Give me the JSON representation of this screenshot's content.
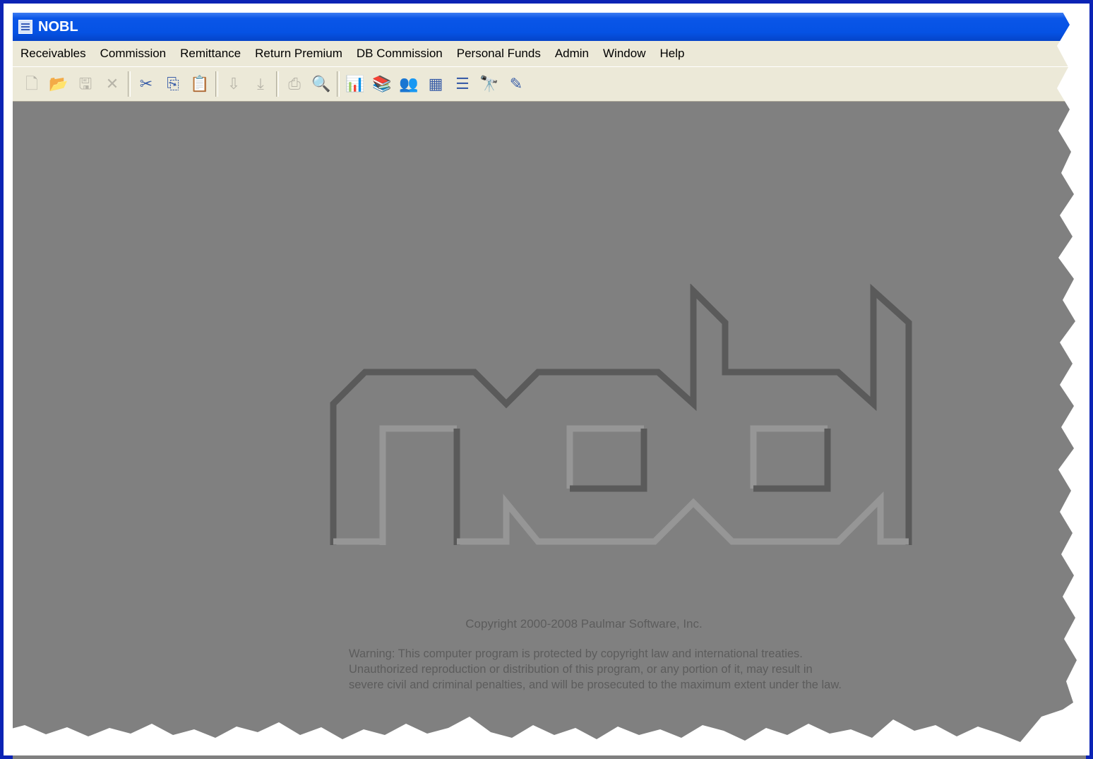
{
  "window": {
    "title": "NOBL"
  },
  "menu": [
    "Receivables",
    "Commission",
    "Remittance",
    "Return Premium",
    "DB Commission",
    "Personal Funds",
    "Admin",
    "Window",
    "Help"
  ],
  "toolbar": {
    "groups": [
      [
        {
          "icon": "new-icon",
          "glyph": "🗋",
          "enabled": false
        },
        {
          "icon": "open-icon",
          "glyph": "📂",
          "enabled": false
        },
        {
          "icon": "save-icon",
          "glyph": "🖫",
          "enabled": false
        },
        {
          "icon": "delete-icon",
          "glyph": "✕",
          "enabled": false
        }
      ],
      [
        {
          "icon": "cut-icon",
          "glyph": "✂",
          "enabled": true
        },
        {
          "icon": "copy-icon",
          "glyph": "⎘",
          "enabled": true
        },
        {
          "icon": "paste-icon",
          "glyph": "📋",
          "enabled": true
        }
      ],
      [
        {
          "icon": "import-icon",
          "glyph": "⇩",
          "enabled": false
        },
        {
          "icon": "export-icon",
          "glyph": "⤓",
          "enabled": false
        }
      ],
      [
        {
          "icon": "print-icon",
          "glyph": "⎙",
          "enabled": false
        },
        {
          "icon": "print-preview-icon",
          "glyph": "🔍",
          "enabled": false
        }
      ],
      [
        {
          "icon": "report-icon",
          "glyph": "📊",
          "enabled": true
        },
        {
          "icon": "stack-icon",
          "glyph": "📚",
          "enabled": true
        },
        {
          "icon": "users-icon",
          "glyph": "👥",
          "enabled": true
        },
        {
          "icon": "calculator-icon",
          "glyph": "▦",
          "enabled": true
        },
        {
          "icon": "list-icon",
          "glyph": "☰",
          "enabled": true
        },
        {
          "icon": "find-icon",
          "glyph": "🔭",
          "enabled": true
        },
        {
          "icon": "notepad-icon",
          "glyph": "✎",
          "enabled": true
        }
      ]
    ]
  },
  "splash": {
    "logo_text": "nobl",
    "copyright": "Copyright 2000-2008 Paulmar Software, Inc.",
    "warning_lines": [
      "Warning:   This  computer program is protected by copyright law and international treaties.",
      "Unauthorized reproduction or distribution of this program, or any portion of it, may result in",
      "severe civil and criminal penalties, and will be prosecuted to the maximum extent under the law."
    ]
  }
}
